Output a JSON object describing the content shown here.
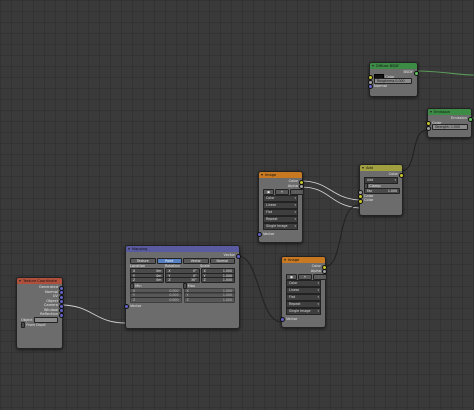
{
  "texcoord": {
    "title": "Texture Coordinate",
    "outputs": [
      "Generated",
      "Normal",
      "UV",
      "Object",
      "Camera",
      "Window",
      "Reflection"
    ],
    "object_label": "Object",
    "from_dupli": "From Dupli"
  },
  "mapping": {
    "title": "Mapping",
    "out_label": "Vector",
    "tabs": [
      "Texture",
      "Point",
      "Vector",
      "Normal"
    ],
    "active_tab": "Point",
    "col_headers": [
      "Location",
      "Rotation",
      "Scale"
    ],
    "rows": [
      {
        "axis": "X",
        "loc": "0m",
        "rot": "0°",
        "scale": "1.000"
      },
      {
        "axis": "Y",
        "loc": "0m",
        "rot": "0°",
        "scale": "1.000"
      },
      {
        "axis": "Z",
        "loc": "0m",
        "rot": "30°",
        "scale": "1.000"
      }
    ],
    "min_label": "Min",
    "max_label": "Max",
    "min_rows": [
      {
        "axis": "X",
        "val": "0.000"
      },
      {
        "axis": "Y",
        "val": "0.000"
      },
      {
        "axis": "Z",
        "val": "0.000"
      }
    ],
    "max_rows": [
      {
        "axis": "X",
        "val": "1.000"
      },
      {
        "axis": "Y",
        "val": "1.000"
      },
      {
        "axis": "Z",
        "val": "1.000"
      }
    ],
    "in_label": "Vector"
  },
  "image1": {
    "title": "Image",
    "outputs": [
      "Color",
      "Alpha"
    ],
    "selects": [
      "Color",
      "Linear",
      "Flat",
      "Repeat",
      "Single Image"
    ],
    "in_label": "Vector"
  },
  "image2": {
    "title": "Image",
    "outputs": [
      "Color",
      "Alpha"
    ],
    "selects": [
      "Color",
      "Linear",
      "Flat",
      "Repeat",
      "Single Image"
    ],
    "in_label": "Vector"
  },
  "add": {
    "title": "Add",
    "out_label": "Color",
    "mode": "Add",
    "clamp_label": "Clamp",
    "fac_label": "Fac",
    "fac_value": "1.000",
    "in_color1": "Color",
    "in_color2": "Color"
  },
  "diffuse": {
    "title": "Diffuse BSDF",
    "out_label": "BSDF",
    "color_label": "Color",
    "roughness": "Roughness 0.000",
    "normal_label": "Normal"
  },
  "emission": {
    "title": "Emission",
    "out_label": "Emission",
    "color_label": "Color",
    "strength": "Strength: 1.000"
  },
  "colors": {
    "vector_socket": "#6363c7",
    "color_socket": "#c7c729",
    "shader_socket": "#63c763"
  }
}
